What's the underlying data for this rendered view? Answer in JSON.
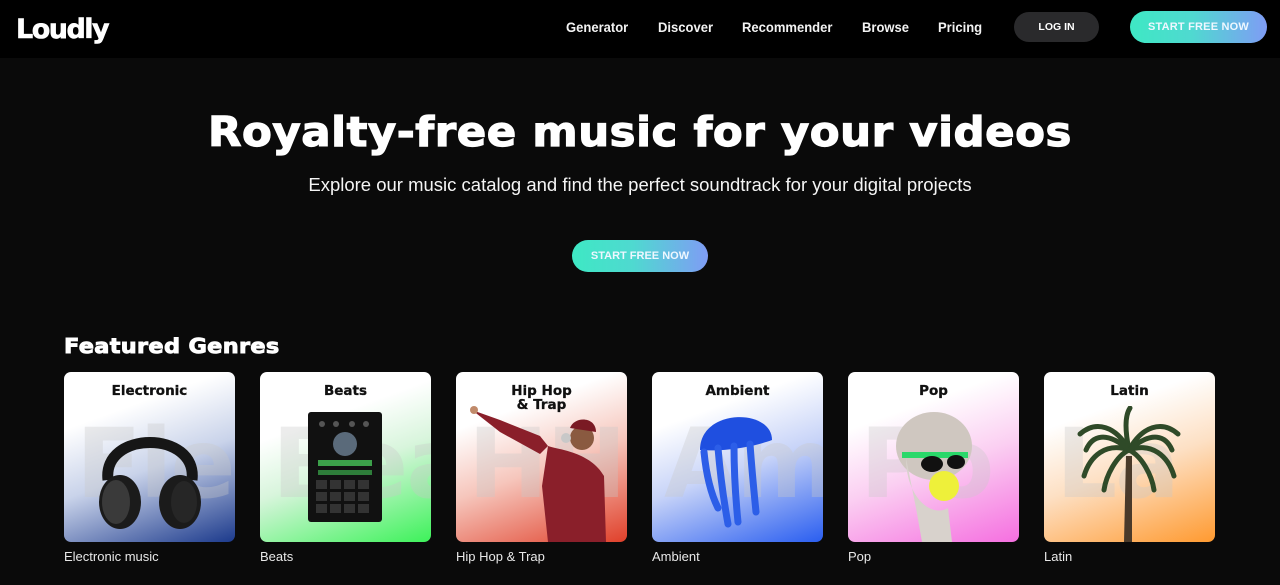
{
  "header": {
    "logo": "Loudly",
    "nav": [
      {
        "label": "Generator"
      },
      {
        "label": "Discover"
      },
      {
        "label": "Recommender"
      },
      {
        "label": "Browse"
      },
      {
        "label": "Pricing"
      }
    ],
    "login_label": "LOG IN",
    "start_label": "START FREE NOW"
  },
  "hero": {
    "title": "Royalty-free music for your videos",
    "subtitle": "Explore our music catalog and find the perfect soundtrack for your digital projects",
    "cta_label": "START FREE NOW"
  },
  "featured": {
    "title": "Featured Genres",
    "genres": [
      {
        "card_title": "Electronic",
        "ghost": "Ele",
        "caption": "Electronic music",
        "image": "headphones-icon",
        "accent": "#1c3a8c"
      },
      {
        "card_title": "Beats",
        "ghost": "Bea",
        "caption": "Beats",
        "image": "drum-machine-icon",
        "accent": "#3df25a"
      },
      {
        "card_title": "Hip Hop\n& Trap",
        "ghost": "HH",
        "caption": "Hip Hop & Trap",
        "image": "rapper-icon",
        "accent": "#e0402a"
      },
      {
        "card_title": "Ambient",
        "ghost": "Am",
        "caption": "Ambient",
        "image": "jellyfish-icon",
        "accent": "#2a5ef0"
      },
      {
        "card_title": "Pop",
        "ghost": "Po",
        "caption": "Pop",
        "image": "statue-bubblegum-icon",
        "accent": "#f56fe0"
      },
      {
        "card_title": "Latin",
        "ghost": "La",
        "caption": "Latin",
        "image": "palm-tree-icon",
        "accent": "#ff9a30"
      }
    ]
  },
  "colors": {
    "gradient_start": "#3ee8c4",
    "gradient_end": "#7f9cf5",
    "login_bg": "#2a2a2c",
    "background": "#0a0a0a"
  }
}
